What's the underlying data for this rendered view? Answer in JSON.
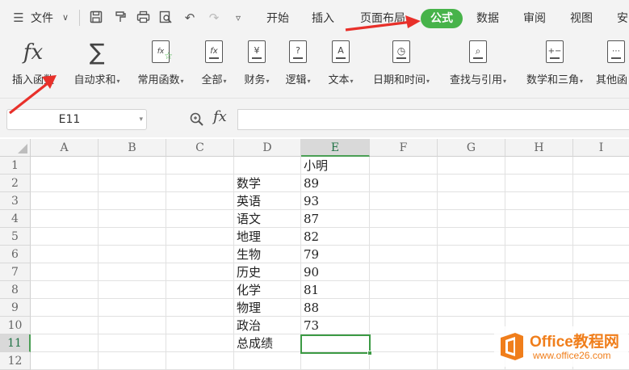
{
  "menubar": {
    "menu_label": "文件",
    "tabs": [
      {
        "label": "开始"
      },
      {
        "label": "插入"
      },
      {
        "label": "页面布局"
      },
      {
        "label": "公式",
        "active": true
      },
      {
        "label": "数据"
      },
      {
        "label": "审阅"
      },
      {
        "label": "视图"
      },
      {
        "label": "安"
      }
    ],
    "active_color": "#47b34a"
  },
  "ribbon": {
    "insert_function": "插入函数",
    "autosum": "自动求和",
    "common": "常用函数",
    "all": "全部",
    "finance": "财务",
    "logic": "逻辑",
    "text": "文本",
    "datetime": "日期和时间",
    "lookup": "查找与引用",
    "math": "数学和三角",
    "other": "其他函",
    "fx_glyph": "fx",
    "sigma_glyph": "∑"
  },
  "formula_bar": {
    "name_box": "E11",
    "fx_label": "fx",
    "value": ""
  },
  "sheet": {
    "columns": [
      "A",
      "B",
      "C",
      "D",
      "E",
      "F",
      "G",
      "H",
      "I"
    ],
    "rows": [
      "1",
      "2",
      "3",
      "4",
      "5",
      "6",
      "7",
      "8",
      "9",
      "10",
      "11",
      "12"
    ],
    "header_cell": "小明",
    "subjects": [
      "数学",
      "英语",
      "语文",
      "地理",
      "生物",
      "历史",
      "化学",
      "物理",
      "政治",
      "总成绩"
    ],
    "scores": [
      "89",
      "93",
      "87",
      "82",
      "79",
      "90",
      "81",
      "88",
      "73"
    ],
    "selected_cell": "E11"
  },
  "watermark": {
    "title": "Office教程网",
    "url": "www.office26.com"
  },
  "colors": {
    "accent": "#47b34a",
    "annotation_red": "#e8302a",
    "watermark": "#f07e1b"
  }
}
